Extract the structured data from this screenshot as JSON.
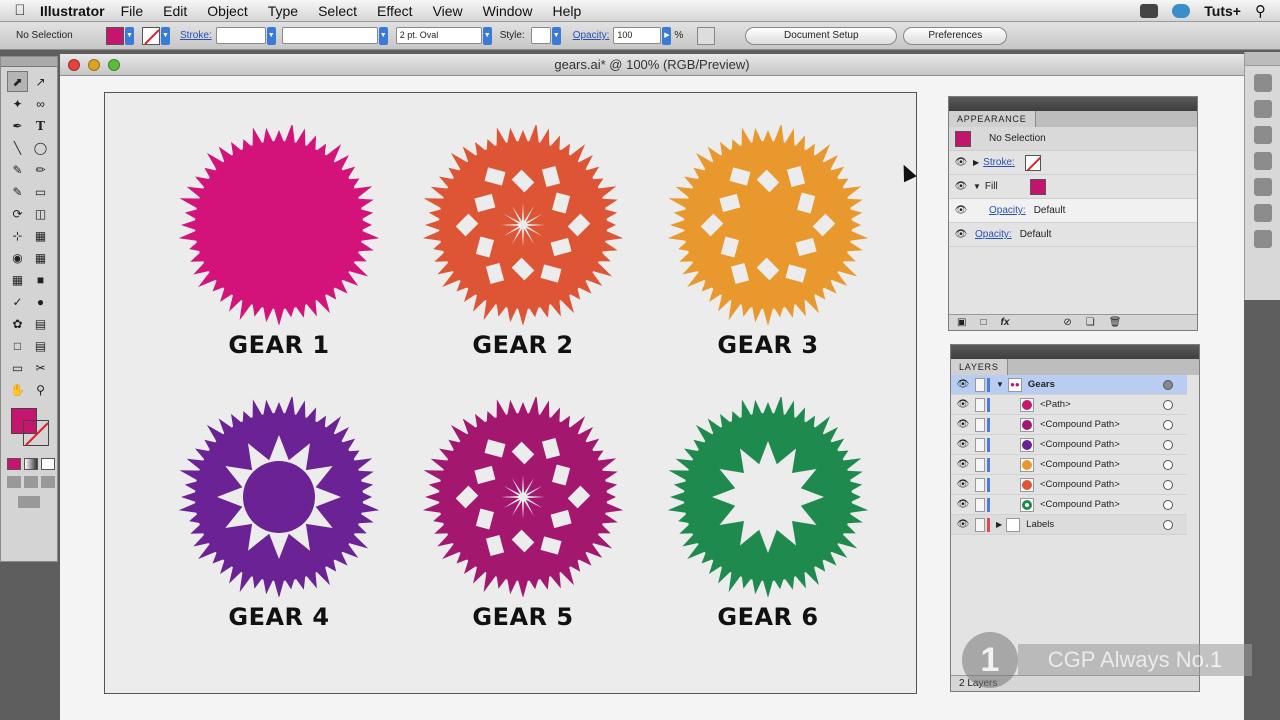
{
  "menubar": {
    "app_name": "Illustrator",
    "menus": [
      "File",
      "Edit",
      "Object",
      "Type",
      "Select",
      "Effect",
      "View",
      "Window",
      "Help"
    ],
    "right_text": "Tuts+"
  },
  "controlbar": {
    "selection_label": "No Selection",
    "stroke_label": "Stroke:",
    "brush_value": "2 pt. Oval",
    "style_label": "Style:",
    "opacity_label": "Opacity:",
    "opacity_value": "100",
    "opacity_unit": "%",
    "document_setup": "Document Setup",
    "preferences": "Preferences"
  },
  "document": {
    "title": "gears.ai* @ 100% (RGB/Preview)",
    "gears": [
      {
        "label": "GEAR 1",
        "color": "#d4137a"
      },
      {
        "label": "GEAR 2",
        "color": "#de5535"
      },
      {
        "label": "GEAR 3",
        "color": "#e8982d"
      },
      {
        "label": "GEAR 4",
        "color": "#6a2294"
      },
      {
        "label": "GEAR 5",
        "color": "#a3186e"
      },
      {
        "label": "GEAR 6",
        "color": "#1f8a4e"
      }
    ]
  },
  "appearance": {
    "tab": "APPEARANCE",
    "header": "No Selection",
    "stroke_label": "Stroke:",
    "fill_label": "Fill",
    "fill_opacity_label": "Opacity:",
    "fill_opacity_value": "Default",
    "opacity_label": "Opacity:",
    "opacity_value": "Default",
    "fill_color": "#c2136d"
  },
  "layers": {
    "tab": "LAYERS",
    "rows": [
      {
        "name": "Gears",
        "color": "#4d7bd8",
        "selected": true
      },
      {
        "name": "<Path>",
        "color": "#c4156f"
      },
      {
        "name": "<Compound Path>",
        "color": "#a3186e"
      },
      {
        "name": "<Compound Path>",
        "color": "#6a2294"
      },
      {
        "name": "<Compound Path>",
        "color": "#e8982d"
      },
      {
        "name": "<Compound Path>",
        "color": "#de5535"
      },
      {
        "name": "<Compound Path>",
        "color": "#1f8a4e"
      },
      {
        "name": "Labels",
        "color": "#d84d4d"
      }
    ],
    "footer": "2 Layers"
  },
  "watermark": {
    "badge": "1",
    "text": "CGP Always No.1"
  }
}
